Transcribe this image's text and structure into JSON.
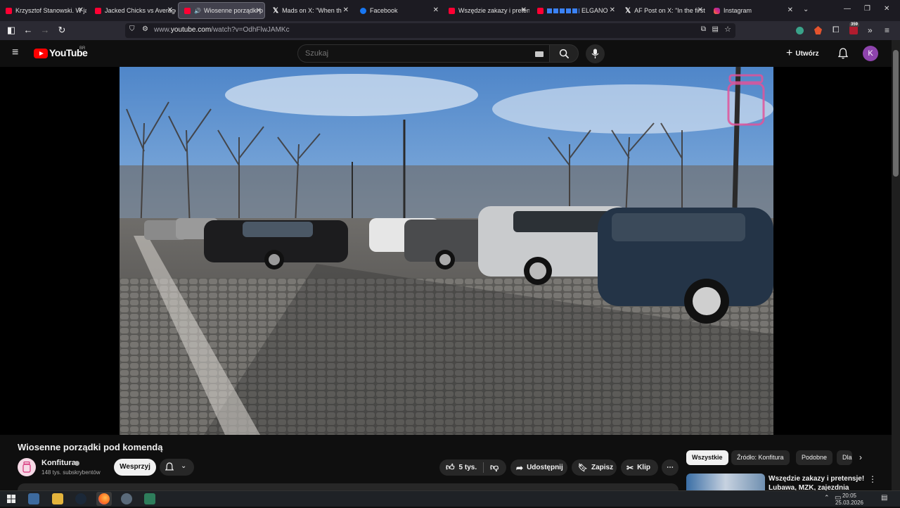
{
  "browser": {
    "tabs": [
      {
        "title": "Krzysztof Stanowski. W jaki",
        "icon": "youtube-icon"
      },
      {
        "title": "Jacked Chicks vs Average",
        "icon": "youtube-icon"
      },
      {
        "title": "Wiosenne porządki p",
        "icon": "youtube-icon",
        "active": true
      },
      {
        "title": "Mads on X: \"When th",
        "icon": "x-icon"
      },
      {
        "title": "Facebook",
        "icon": "facebook-icon"
      },
      {
        "title": "Wszędzie zakazy i preten",
        "icon": "youtube-icon"
      },
      {
        "title": "ELGANO",
        "icon": "youtube-icon"
      },
      {
        "title": "AF Post on X: \"In the first",
        "icon": "x-icon"
      },
      {
        "title": "Instagram",
        "icon": "instagram-icon"
      }
    ],
    "url_prefix": "www.",
    "url_host": "youtube.com",
    "url_path": "/watch?v=OdhFlwJAMKc",
    "extension_badge": "359"
  },
  "youtube": {
    "logo_text": "YouTube",
    "region": "BR",
    "search_placeholder": "Szukaj",
    "create_label": "Utwórz",
    "avatar_letter": "K"
  },
  "video": {
    "title": "Wiosenne porządki pod komendą",
    "channel": "Konfitura",
    "subscribers": "148 tys. subskrybentów",
    "support_label": "Wesprzyj",
    "likes": "5 tys.",
    "share_label": "Udostępnij",
    "save_label": "Zapisz",
    "clip_label": "Klip"
  },
  "sidebar": {
    "chips": [
      "Wszystkie",
      "Źródło: Konfitura",
      "Podobne",
      "Dla"
    ],
    "recommendation": {
      "title": "Wszędzie zakazy i pretensje! Lubawa, MZK, zajezdnia"
    }
  },
  "taskbar": {
    "time": "20:05",
    "date": "25.03.2026"
  },
  "colors": {
    "brand_red": "#ff0000",
    "background": "#0f0f0f",
    "avatar": "#8e44ad"
  }
}
